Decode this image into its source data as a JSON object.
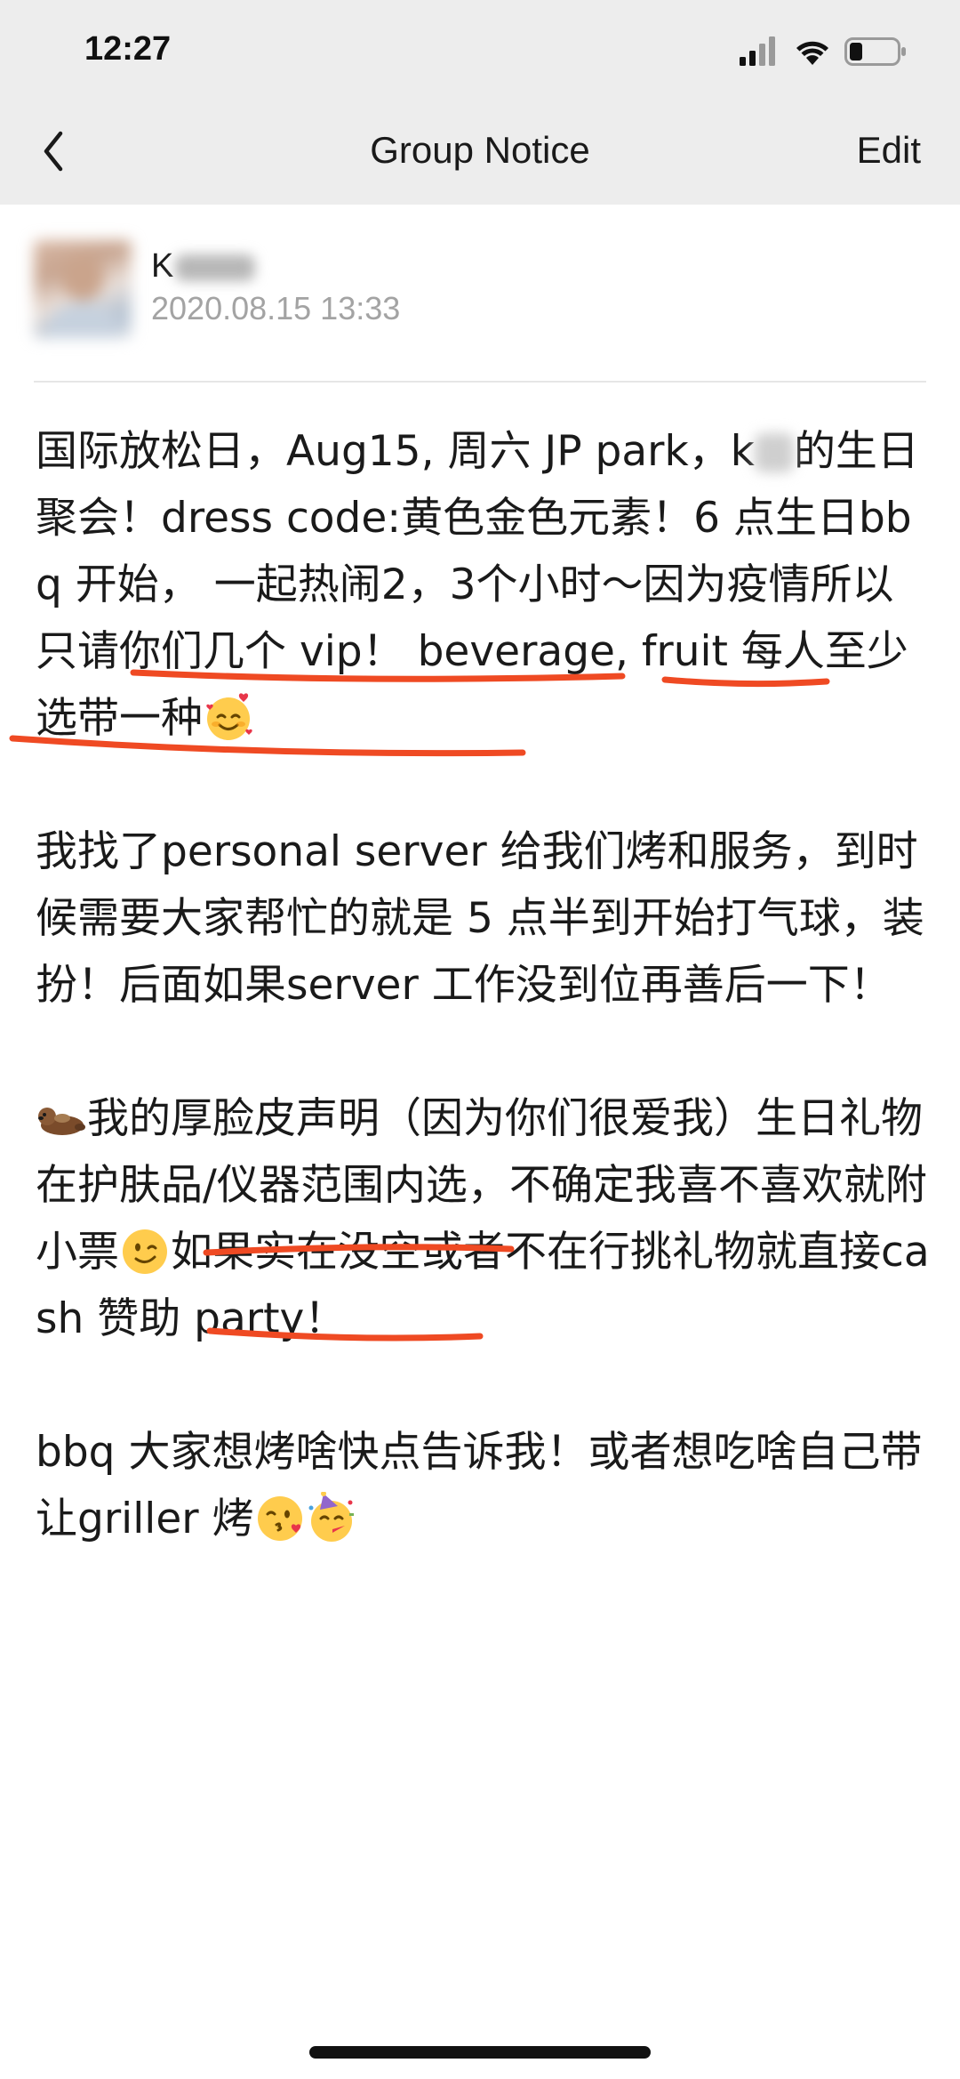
{
  "status_bar": {
    "time": "12:27"
  },
  "nav": {
    "title": "Group Notice",
    "edit_label": "Edit"
  },
  "author": {
    "name": "K",
    "date": "2020.08.15  13:33"
  },
  "notice": {
    "p1_a": "国际放松日，Aug15, 周六 JP park，k",
    "p1_b": "的生日聚会！dress code:黄色金色元素！6 点生日bbq 开始， 一起热闹2，3个小时～因为疫情所以只请你们几个 vip！ beverage, fruit 每人至少选带一种",
    "p2": "我找了personal server 给我们烤和服务，到时候需要大家帮忙的就是 5 点半到开始打气球，装扮！后面如果server 工作没到位再善后一下！",
    "p3_a": "我的厚脸皮声明（因为你们很爱我）生日礼物在护肤品/仪器范围内选，不确定我喜不喜欢就附小票",
    "p3_b": "如果实在没空或者不在行挑礼物就直接cash 赞助 party！",
    "p4": "bbq 大家想烤啥快点告诉我！或者想吃啥自己带让griller 烤"
  },
  "icons": {
    "back": "chevron-left-icon",
    "signal": "cellular-signal-icon",
    "wifi": "wifi-icon",
    "battery": "battery-icon",
    "emoji_love": "smiling-face-with-hearts-emoji",
    "emoji_otter": "otter-emoji",
    "emoji_wink": "winking-face-emoji",
    "emoji_kiss": "face-blowing-kiss-emoji",
    "emoji_party": "partying-face-emoji"
  },
  "colors": {
    "nav_background": "#ededed",
    "date_text": "#a3a3a3",
    "annotation_underline": "#ef4a23"
  }
}
